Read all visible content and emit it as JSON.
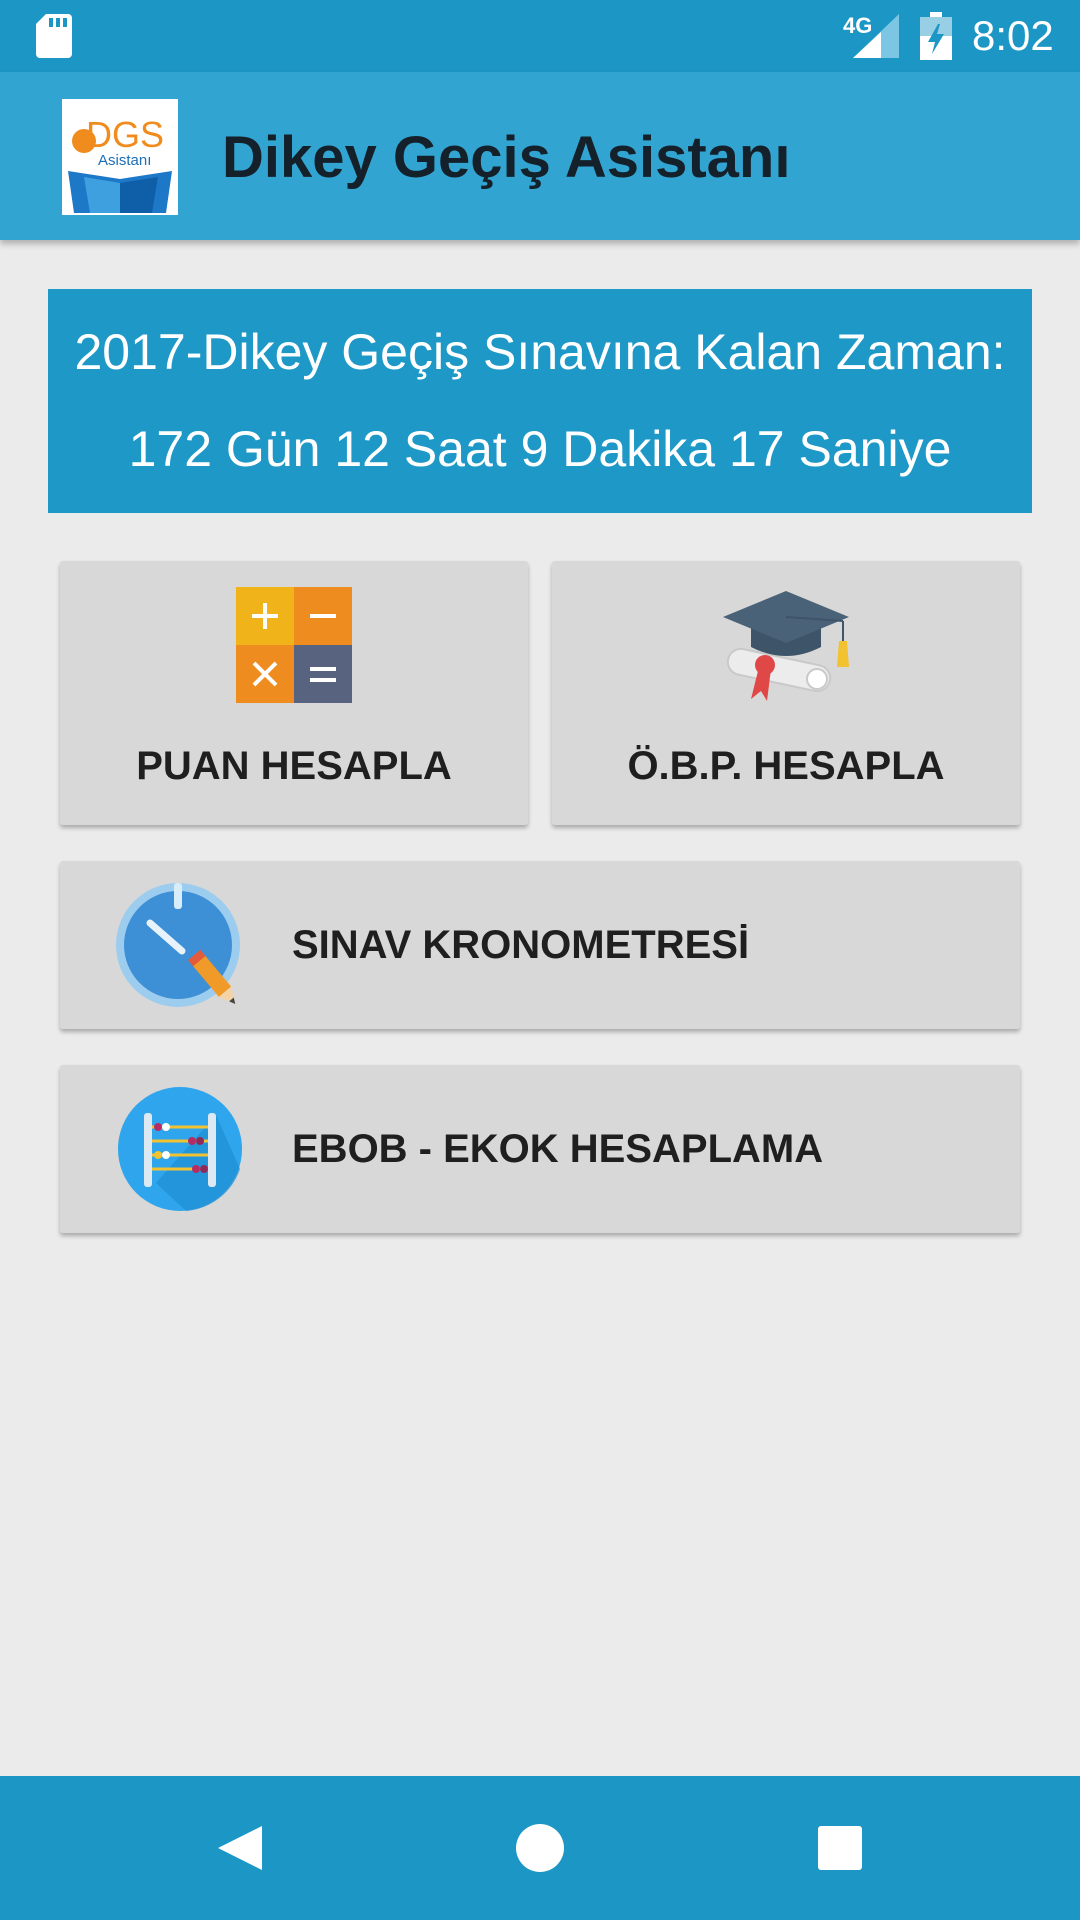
{
  "status_bar": {
    "network": "4G",
    "time": "8:02",
    "icons": [
      "sd-card-icon",
      "signal-icon",
      "battery-charging-icon"
    ]
  },
  "app_bar": {
    "logo_text": "DGS",
    "logo_subtext": "Asistanı",
    "title": "Dikey Geçiş Asistanı"
  },
  "countdown": {
    "title": "2017-Dikey Geçiş Sınavına Kalan Zaman:",
    "value": "172 Gün 12 Saat 9 Dakika 17 Saniye"
  },
  "menu": {
    "puan": {
      "label": "PUAN HESAPLA",
      "icon": "calculator-icon"
    },
    "obp": {
      "label": "Ö.B.P. HESAPLA",
      "icon": "graduation-cap-icon"
    },
    "kronometre": {
      "label": "SINAV KRONOMETRESİ",
      "icon": "stopwatch-icon"
    },
    "ebob": {
      "label": "EBOB - EKOK HESAPLAMA",
      "icon": "abacus-icon"
    }
  },
  "nav_bar": {
    "buttons": [
      "back-icon",
      "home-icon",
      "recents-icon"
    ]
  },
  "colors": {
    "status_bar": "#1c96c5",
    "app_bar": "#32a4d1",
    "banner": "#1d98c7",
    "card": "#d8d8d8",
    "background": "#ebebeb"
  }
}
